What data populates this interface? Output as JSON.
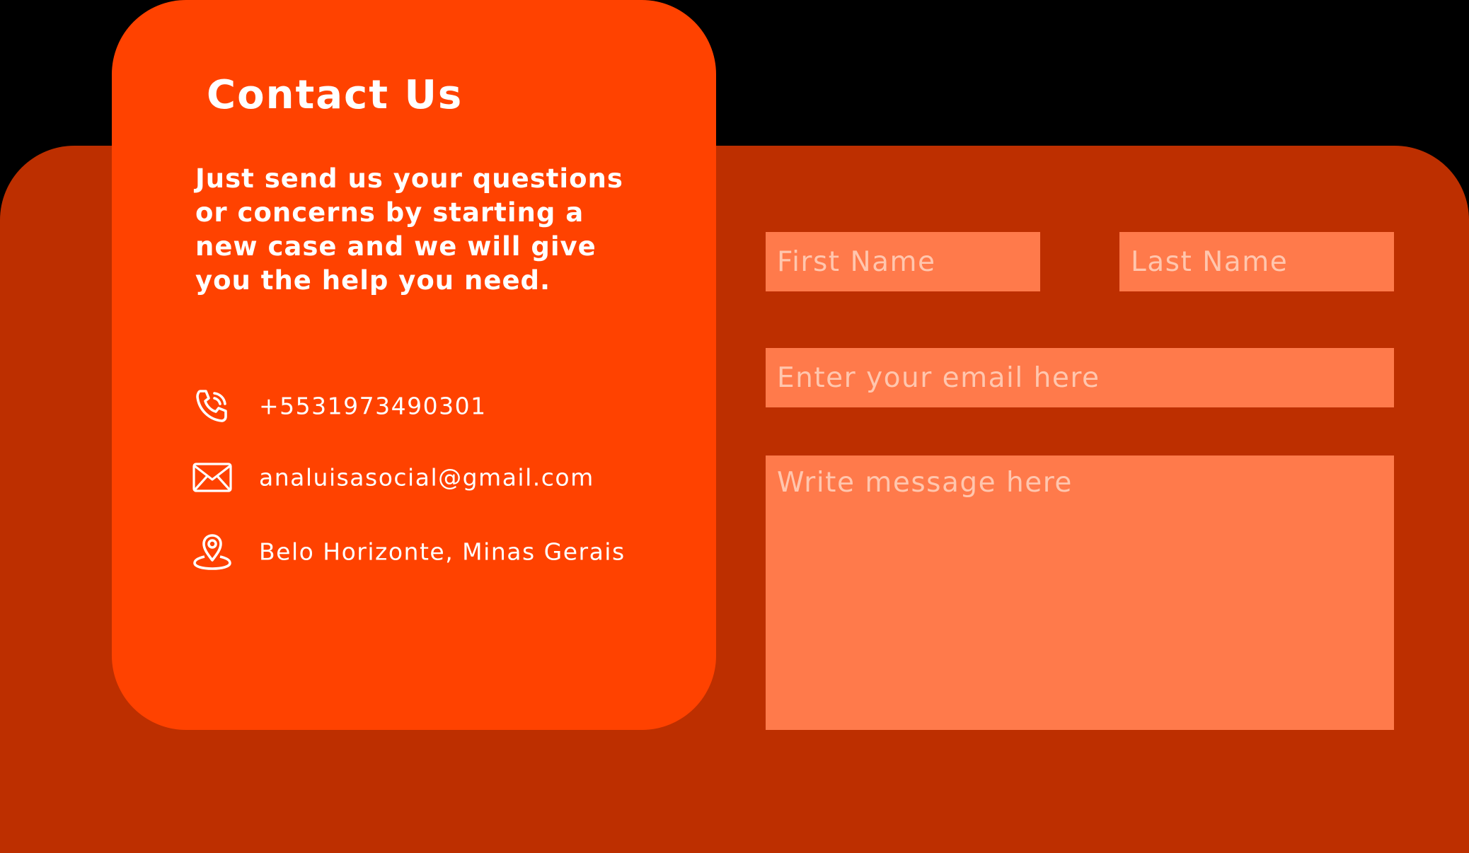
{
  "colors": {
    "background": "#000000",
    "back_panel": "#BD2F00",
    "info_card": "#FF4200",
    "field": "#FF7A4B",
    "placeholder": "#FFC6AE",
    "text": "#FFFFFF"
  },
  "contact": {
    "title": "Contact Us",
    "description": "Just send us your questions or concerns by starting a new case and we will give you the help you need.",
    "phone": {
      "icon": "phone-icon",
      "value": "+5531973490301"
    },
    "email": {
      "icon": "envelope-icon",
      "value": "analuisasocial@gmail.com"
    },
    "location": {
      "icon": "map-pin-icon",
      "value": "Belo Horizonte, Minas Gerais"
    }
  },
  "form": {
    "first_name": {
      "placeholder": "First Name",
      "value": ""
    },
    "last_name": {
      "placeholder": "Last Name",
      "value": ""
    },
    "email": {
      "placeholder": "Enter your email here",
      "value": ""
    },
    "message": {
      "placeholder": "Write message here",
      "value": ""
    }
  }
}
